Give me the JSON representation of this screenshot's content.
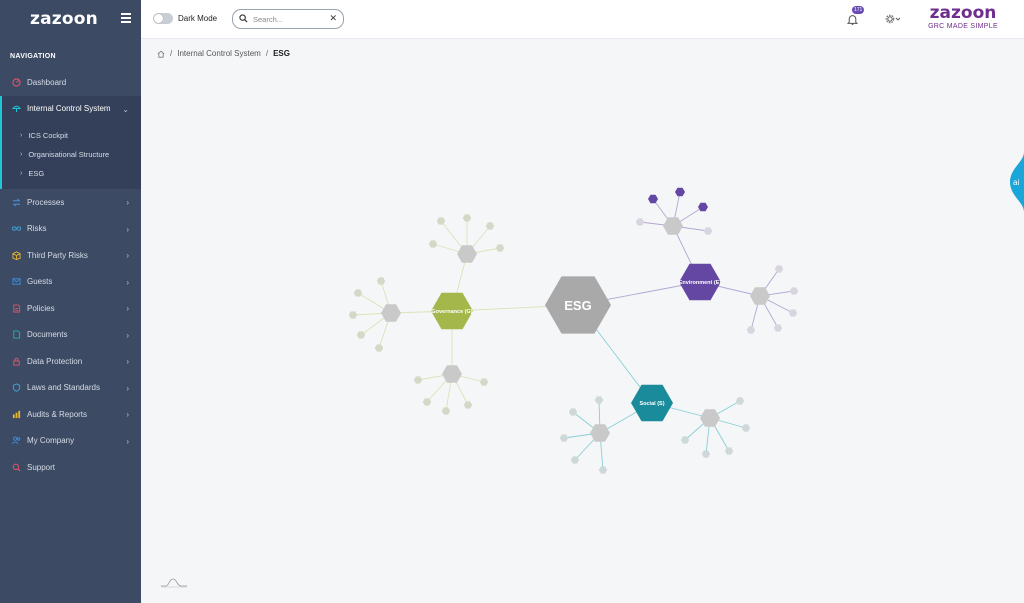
{
  "app": {
    "logo": "zazoon"
  },
  "sidebar": {
    "nav_title": "NAVIGATION",
    "items": [
      {
        "label": "Dashboard",
        "icon": "dashboard-icon",
        "color": "#e0566b"
      },
      {
        "label": "Internal Control System",
        "icon": "umbrella-icon",
        "color": "#1ec6d8"
      },
      {
        "label": "Processes",
        "icon": "processes-icon",
        "color": "#4a90e2"
      },
      {
        "label": "Risks",
        "icon": "infinity-icon",
        "color": "#3fa7e0"
      },
      {
        "label": "Third Party Risks",
        "icon": "box-icon",
        "color": "#e8b830"
      },
      {
        "label": "Guests",
        "icon": "mail-icon",
        "color": "#3f8fe0"
      },
      {
        "label": "Policies",
        "icon": "policy-icon",
        "color": "#e0566b"
      },
      {
        "label": "Documents",
        "icon": "document-icon",
        "color": "#26b3a4"
      },
      {
        "label": "Data Protection",
        "icon": "lock-icon",
        "color": "#e0566b"
      },
      {
        "label": "Laws and Standards",
        "icon": "shield-icon",
        "color": "#3fa7e0"
      },
      {
        "label": "Audits & Reports",
        "icon": "chart-icon",
        "color": "#e8b830"
      },
      {
        "label": "My Company",
        "icon": "users-icon",
        "color": "#3f8fe0"
      },
      {
        "label": "Support",
        "icon": "support-icon",
        "color": "#e0566b"
      }
    ],
    "sub_items": [
      {
        "label": "ICS Cockpit"
      },
      {
        "label": "Organisational Structure"
      },
      {
        "label": "ESG"
      }
    ]
  },
  "topbar": {
    "dark_mode_label": "Dark Mode",
    "search_placeholder": "Search...",
    "notification_count": "171"
  },
  "brand": {
    "name": "zazoon",
    "tagline": "GRC MADE SIMPLE"
  },
  "breadcrumb": {
    "level1": "Internal Control System",
    "current": "ESG"
  },
  "graph": {
    "center": {
      "label": "ESG",
      "color": "#a9a9a9"
    },
    "branches": [
      {
        "label": "Governance (G)",
        "color": "#a3b74b",
        "edge_color": "#dce3b6"
      },
      {
        "label": "Environment (E)",
        "color": "#6447a3",
        "edge_color": "#b3a7d3"
      },
      {
        "label": "Social (S)",
        "color": "#1a8b9a",
        "edge_color": "#88cfd6"
      }
    ]
  },
  "ai_tab": {
    "label": "ai",
    "color": "#1aa6d8"
  }
}
